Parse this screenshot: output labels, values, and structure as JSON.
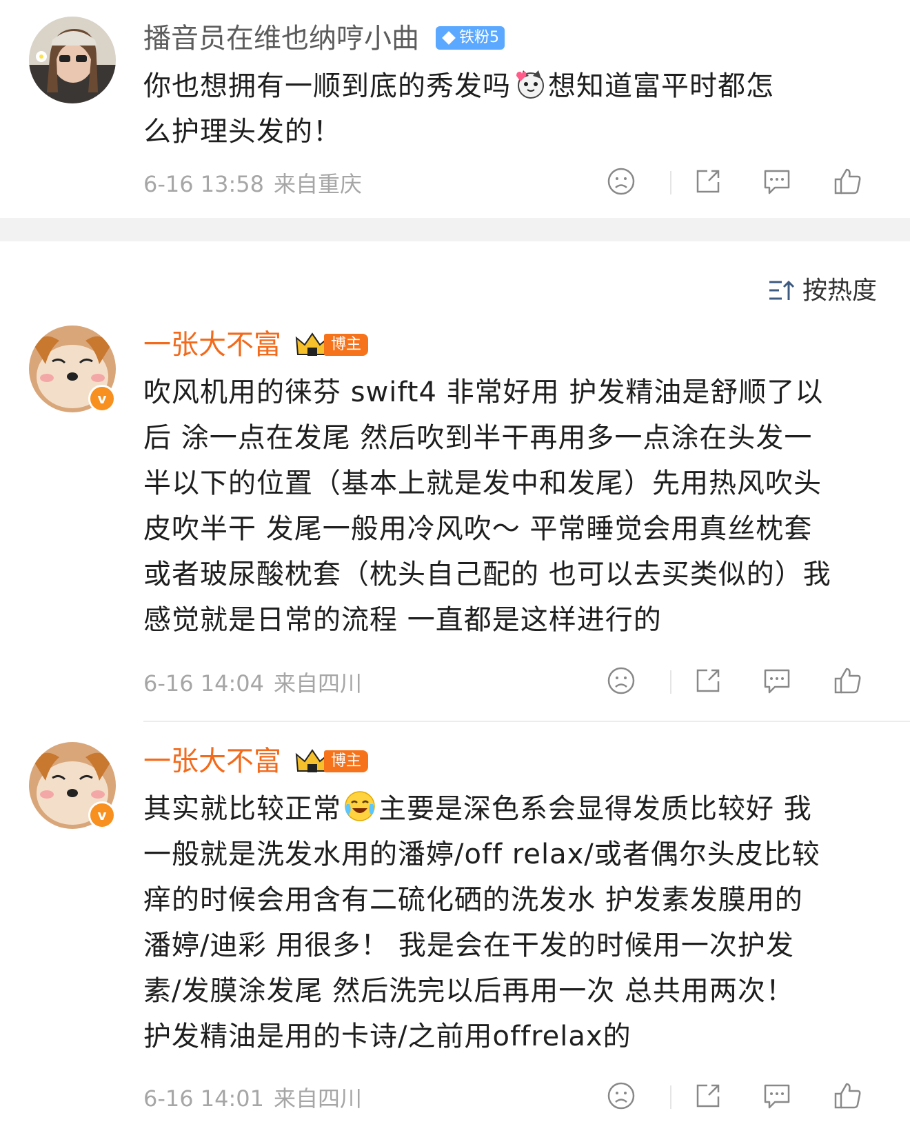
{
  "post": {
    "username": "播音员在维也纳哼小曲",
    "fan_badge": "铁粉5",
    "text_lines": [
      "你也想拥有一顺到底的秀发吗",
      "想知道富平时都怎",
      "么护理头发的！"
    ],
    "emoji": "cat-heart-emoji",
    "date": "6-16 13:58",
    "location": "来自重庆"
  },
  "sort_label": "按热度",
  "comments": [
    {
      "username": "一张大不富",
      "badge": "博主",
      "lines": [
        "吹风机用的徕芬 swift4 非常好用 护发精油是舒顺了以",
        "后 涂一点在发尾 然后吹到半干再用多一点涂在头发一",
        "半以下的位置（基本上就是发中和发尾）先用热风吹头",
        "皮吹半干 发尾一般用冷风吹～ 平常睡觉会用真丝枕套",
        "或者玻尿酸枕套（枕头自己配的 也可以去买类似的）我",
        "感觉就是日常的流程 一直都是这样进行的"
      ],
      "date": "6-16 14:04",
      "location": "来自四川"
    },
    {
      "username": "一张大不富",
      "badge": "博主",
      "line1_a": "其实就比较正常",
      "line1_b": "主要是深色系会显得发质比较好 我",
      "emoji": "crying-laughing-emoji",
      "lines": [
        "一般就是洗发水用的潘婷/off relax/或者偶尔头皮比较",
        "痒的时候会用含有二硫化硒的洗发水 护发素发膜用的",
        "潘婷/迪彩 用很多！ 我是会在干发的时候用一次护发",
        "素/发膜涂发尾 然后洗完以后再用一次 总共用两次！",
        "护发精油是用的卡诗/之前用offrelax的"
      ],
      "date": "6-16 14:01",
      "location": "来自四川"
    }
  ],
  "colors": {
    "orange_name": "#f26a1b",
    "fan_badge_blue": "#5aa8ff",
    "meta_gray": "#a6a6a6",
    "verified_orange": "#f7901e"
  }
}
